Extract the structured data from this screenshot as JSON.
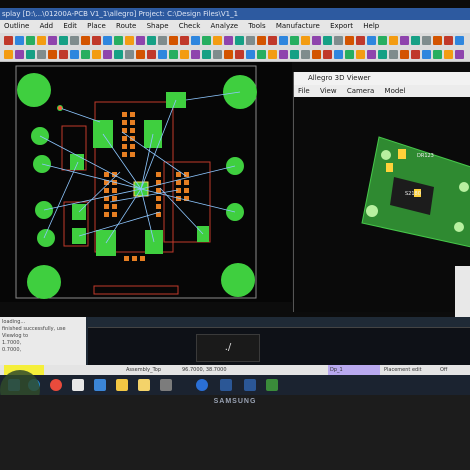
{
  "window": {
    "title": "splay  [D:\\...\\01200A-PCB V1_1\\allegro]  Project: C:\\Design Files\\V1_1"
  },
  "menu": [
    "Outline",
    "Add",
    "Edit",
    "Place",
    "Route",
    "Shape",
    "Check",
    "Analyze",
    "Tools",
    "Manufacture",
    "Export",
    "Help"
  ],
  "viewer3d": {
    "title": "Allegro 3D Viewer",
    "menu": [
      "File",
      "View",
      "Camera",
      "Model"
    ],
    "board_labels": [
      "DR123",
      "S2180"
    ]
  },
  "console": {
    "lines": [
      "loading...",
      "finished successfully, use Viewlog to",
      "1.7000,",
      "0.7000,"
    ],
    "command_value": "./"
  },
  "statusbar": {
    "subclass": "Assembly_Top",
    "coords": "96.7000, 38.7000",
    "mode": "Placement edit",
    "field": "Dp_1",
    "grid": "Off"
  },
  "taskbar": {
    "icons": [
      "windows-icon",
      "edge-icon",
      "chrome-icon",
      "mail-icon",
      "store-icon",
      "explorer-icon",
      "folder-icon",
      "tool-icon",
      "ie-icon",
      "word-icon",
      "excel-icon",
      "word-icon-2",
      "allegro-icon"
    ]
  },
  "monitor": {
    "brand": "SAMSUNG"
  },
  "colors": {
    "pad": "#3fcf3f",
    "via": "#ff5b3a",
    "route": "#8ec7ff",
    "outline": "#c0392b"
  }
}
